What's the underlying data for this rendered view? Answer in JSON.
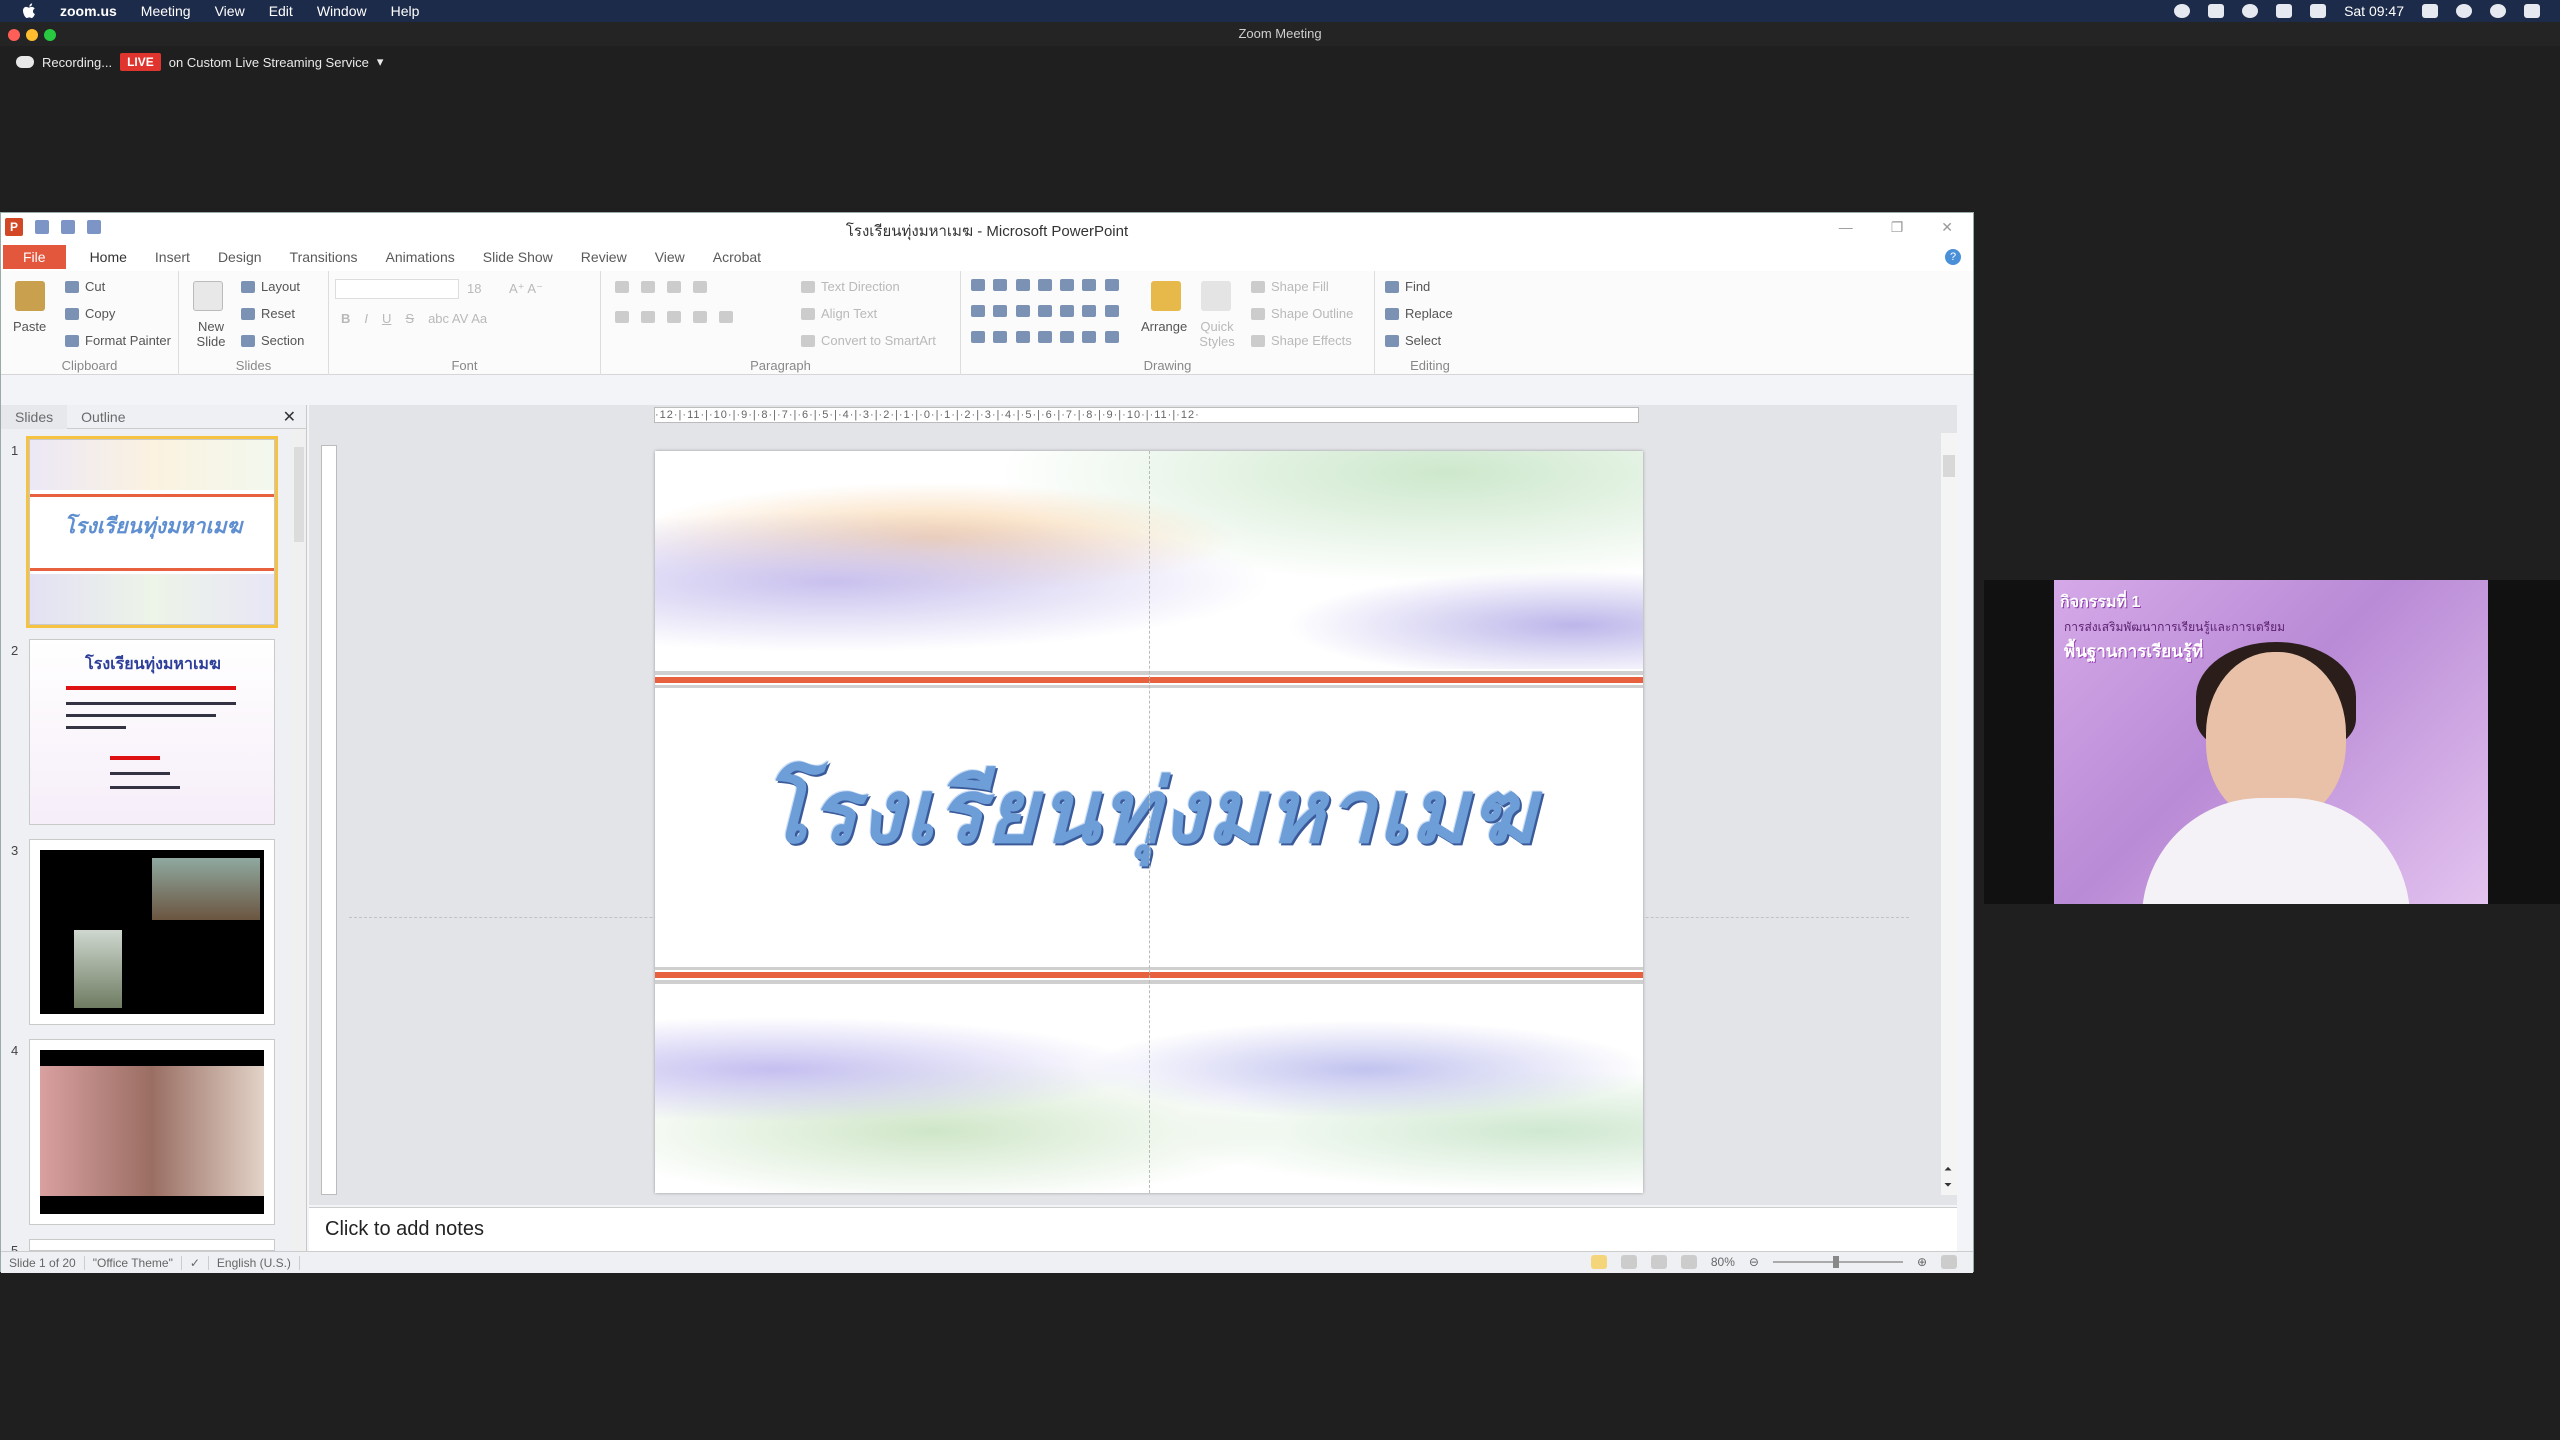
{
  "menubar": {
    "app": "zoom.us",
    "items": [
      "Meeting",
      "View",
      "Edit",
      "Window",
      "Help"
    ],
    "clock": "Sat 09:47"
  },
  "zoom": {
    "window_title": "Zoom Meeting",
    "recording_label": "Recording...",
    "live_badge": "LIVE",
    "stream_label": "on Custom Live Streaming Service"
  },
  "ppt": {
    "window_title": "โรงเรียนทุ่งมหาเมฆ - Microsoft PowerPoint",
    "tabs": [
      "File",
      "Home",
      "Insert",
      "Design",
      "Transitions",
      "Animations",
      "Slide Show",
      "Review",
      "View",
      "Acrobat"
    ],
    "ribbon": {
      "clipboard": {
        "label": "Clipboard",
        "paste": "Paste",
        "cut": "Cut",
        "copy": "Copy",
        "format_painter": "Format Painter"
      },
      "slides": {
        "label": "Slides",
        "new_slide": "New Slide",
        "layout": "Layout",
        "reset": "Reset",
        "section": "Section"
      },
      "font": {
        "label": "Font",
        "size": "18"
      },
      "paragraph": {
        "label": "Paragraph",
        "text_direction": "Text Direction",
        "align_text": "Align Text",
        "convert_smartart": "Convert to SmartArt"
      },
      "drawing": {
        "label": "Drawing",
        "arrange": "Arrange",
        "quick_styles": "Quick Styles",
        "shape_fill": "Shape Fill",
        "shape_outline": "Shape Outline",
        "shape_effects": "Shape Effects"
      },
      "editing": {
        "label": "Editing",
        "find": "Find",
        "replace": "Replace",
        "select": "Select"
      }
    },
    "panel": {
      "tab_slides": "Slides",
      "tab_outline": "Outline",
      "thumbs": [
        {
          "num": "1",
          "title": "โรงเรียนทุ่งมหาเมฆ"
        },
        {
          "num": "2",
          "title": "โรงเรียนทุ่งมหาเมฆ"
        },
        {
          "num": "3"
        },
        {
          "num": "4"
        },
        {
          "num": "5"
        }
      ]
    },
    "ruler": "·12·|·11·|·10·|·9·|·8·|·7·|·6·|·5·|·4·|·3·|·2·|·1·|·0·|·1·|·2·|·3·|·4·|·5·|·6·|·7·|·8·|·9·|·10·|·11·|·12·",
    "slide": {
      "title": "โรงเรียนทุ่งมหาเมฆ"
    },
    "notes_placeholder": "Click to add notes",
    "status": {
      "slide": "Slide 1 of 20",
      "theme": "\"Office Theme\"",
      "language": "English (U.S.)",
      "zoom": "80%"
    }
  },
  "webcam": {
    "caption1": "กิจกรรมที่ 1",
    "caption2": "การส่งเสริมพัฒนาการเรียนรู้และการเตรียม",
    "caption3": "พื้นฐานการเรียนรู้ที่"
  },
  "colors": {
    "file_tab": "#e3573d",
    "live": "#e0342f",
    "slide_stripe": "#e8613f",
    "selected_thumb": "#f5c242"
  }
}
